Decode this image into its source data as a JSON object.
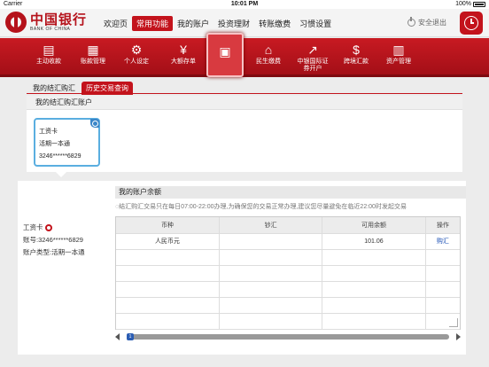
{
  "status_bar": {
    "carrier": "Carrier",
    "time": "10:01 PM",
    "battery": "100%"
  },
  "brand": {
    "name_cn": "中国银行",
    "name_en": "BANK OF CHINA",
    "color": "#c3131c"
  },
  "top_nav": {
    "items": [
      "欢迎页",
      "常用功能",
      "我的账户",
      "投资理财",
      "转账缴费",
      "习惯设置"
    ],
    "active": "常用功能"
  },
  "header_actions": {
    "logout_label": "安全退出"
  },
  "func_bar": {
    "items": [
      {
        "label": "主动收款",
        "icon": "payment-icon"
      },
      {
        "label": "账款管理",
        "icon": "ledger-icon"
      },
      {
        "label": "个人设定",
        "icon": "gear-icon"
      },
      {
        "label": "大额存单",
        "icon": "deposit-icon"
      },
      {
        "label": "",
        "icon": "exchange-icon",
        "active": true
      },
      {
        "label": "民生缴费",
        "icon": "home-icon"
      },
      {
        "label": "中银国际证券开户",
        "icon": "chart-icon"
      },
      {
        "label": "跨境汇款",
        "icon": "remittance-icon"
      },
      {
        "label": "资产管理",
        "icon": "asset-icon"
      }
    ]
  },
  "tabs": {
    "selected": "我的结汇购汇",
    "other": "历史交易查询"
  },
  "account_panel": {
    "title": "我的结汇购汇账户",
    "card": {
      "type": "工资卡",
      "product": "活期一本通",
      "number": "3246******6829"
    }
  },
  "account_info": {
    "card_type": "工资卡",
    "number_line": "账号:3246******6829",
    "type_line": "账户类型:活期一本通"
  },
  "balance": {
    "title": "我的账户余额",
    "notice": "结汇购汇交易只在每日07:00-22:00办理,为确保您的交易正常办理,建议您尽量避免在临近22:00时发起交易",
    "columns": [
      "币种",
      "钞汇",
      "可用余额",
      "操作"
    ],
    "rows": [
      {
        "currency": "人民币元",
        "cash_remit": "",
        "available": "101.06",
        "action": "购汇"
      }
    ],
    "empty_rows": 5
  },
  "scrollbar": {
    "page": "1"
  }
}
